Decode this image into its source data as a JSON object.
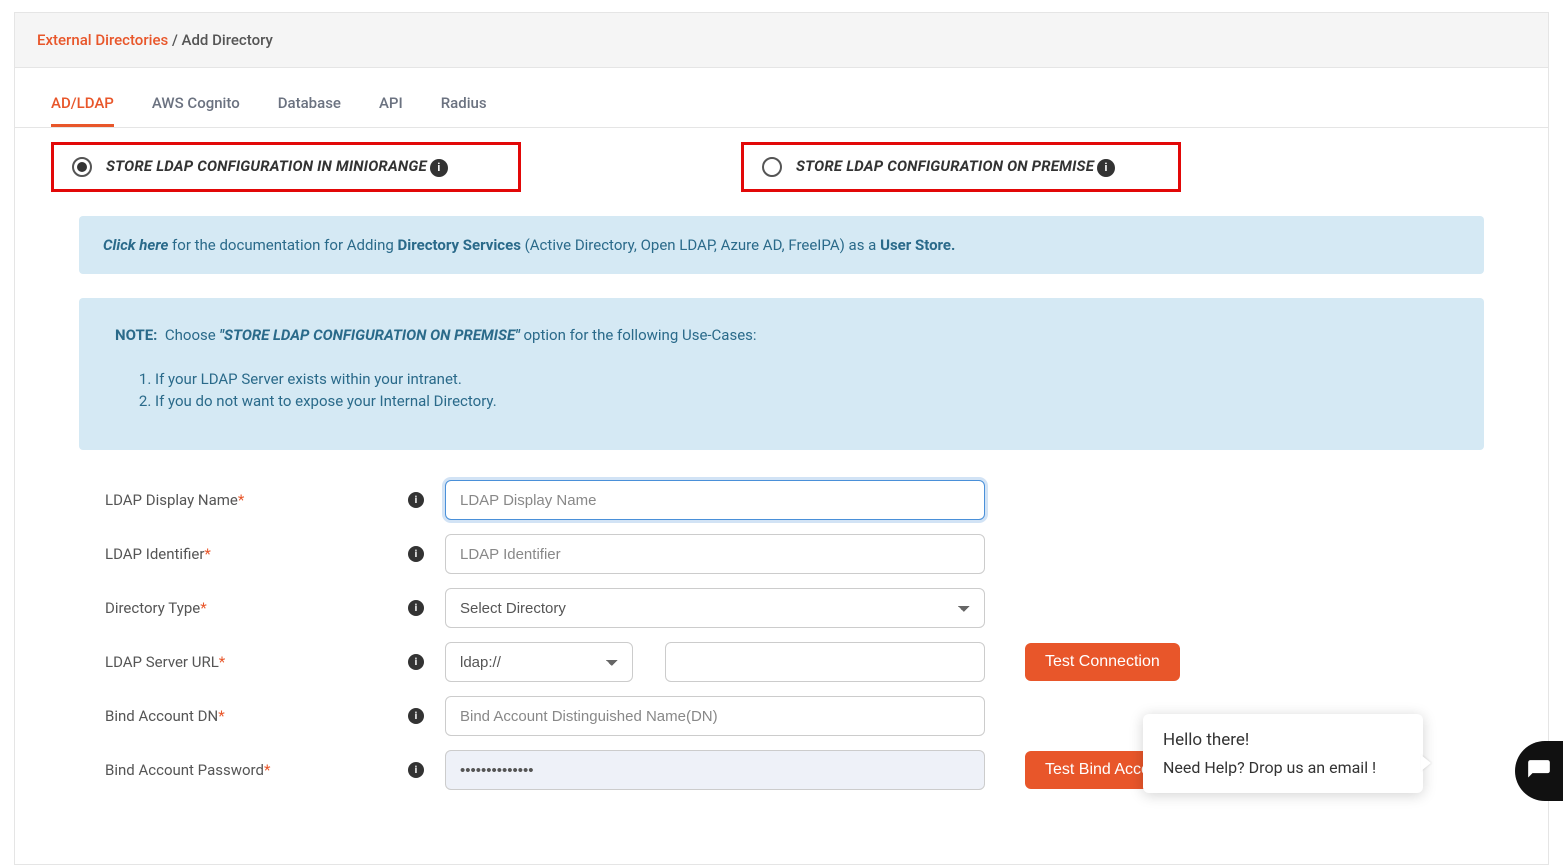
{
  "breadcrumb": {
    "parent": "External Directories",
    "current": "Add Directory"
  },
  "tabs": [
    "AD/LDAP",
    "AWS Cognito",
    "Database",
    "API",
    "Radius"
  ],
  "radios": {
    "opt1": "STORE LDAP CONFIGURATION IN MINIORANGE",
    "opt2": "STORE LDAP CONFIGURATION ON PREMISE"
  },
  "banner": {
    "click": "Click here",
    "pre": " for the documentation for Adding ",
    "b1": "Directory Services",
    "mid": " (Active Directory, Open LDAP, Azure AD, FreeIPA) as a ",
    "b2": "User Store."
  },
  "note": {
    "label": "NOTE:",
    "choose": "Choose ",
    "emph": "\"STORE LDAP CONFIGURATION ON PREMISE\"",
    "after": " option for the following Use-Cases:",
    "li1": "If your LDAP Server exists within your intranet.",
    "li2": "If you do not want to expose your Internal Directory."
  },
  "form": {
    "labels": {
      "display": "LDAP Display Name",
      "identifier": "LDAP Identifier",
      "dirtype": "Directory Type",
      "server": "LDAP Server URL",
      "binddn": "Bind Account DN",
      "bindpw": "Bind Account Password"
    },
    "placeholders": {
      "display": "LDAP Display Name",
      "identifier": "LDAP Identifier",
      "dirtype": "Select Directory",
      "proto": "ldap://",
      "binddn": "Bind Account Distinguished Name(DN)"
    },
    "values": {
      "bindpw": "••••••••••••••"
    },
    "buttons": {
      "test_conn": "Test Connection",
      "test_bind": "Test Bind Accoun"
    }
  },
  "chat": {
    "line1": "Hello there!",
    "line2": "Need Help? Drop us an email !"
  }
}
